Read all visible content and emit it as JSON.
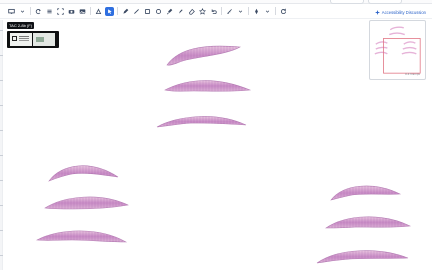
{
  "case_label": "TAC 2-8b (F)",
  "assistant": {
    "label": "Accessibility Discussion",
    "icon": "sparkle-icon"
  },
  "toolbar": {
    "icons": [
      "display-icon",
      "rotate-icon",
      "list-icon",
      "fit-icon",
      "camera-icon",
      "image-icon",
      "annotation-icon",
      "select-icon",
      "pen-icon",
      "line-icon",
      "rectangle-icon",
      "ellipse-icon",
      "brush-icon",
      "marker-icon",
      "eraser-icon",
      "star-icon",
      "undo-icon",
      "measure-icon",
      "compass-icon",
      "refresh-icon"
    ]
  },
  "minimap": {
    "scale": "0.47mm/px"
  },
  "colors": {
    "accent": "#2f6fe0",
    "tissue": "#d9a8cf",
    "tissue_dark": "#b06bb0",
    "highlight": "#e07080"
  }
}
